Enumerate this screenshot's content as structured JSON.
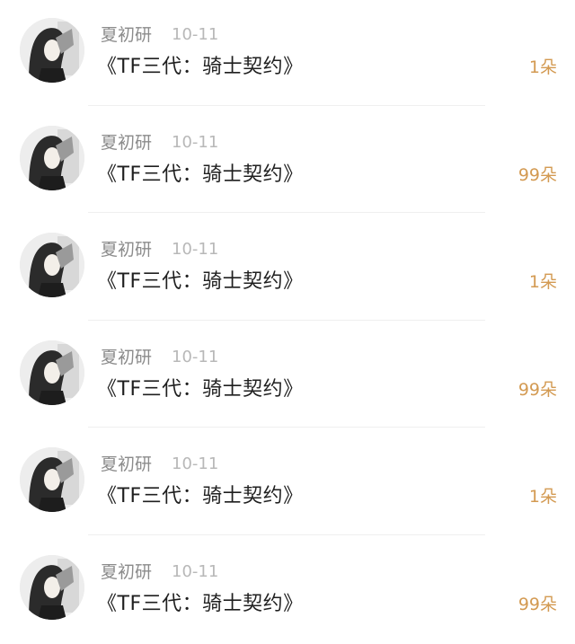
{
  "colors": {
    "username": "#8b8b8b",
    "date": "#b8b8b8",
    "title": "#1f1f1f",
    "count": "#d39a52",
    "divider": "#efefef"
  },
  "rows": [
    {
      "username": "夏初研",
      "date": "10-11",
      "title": "《TF三代：骑士契约》",
      "count": "1朵",
      "avatar_icon": "user-avatar"
    },
    {
      "username": "夏初研",
      "date": "10-11",
      "title": "《TF三代：骑士契约》",
      "count": "99朵",
      "avatar_icon": "user-avatar"
    },
    {
      "username": "夏初研",
      "date": "10-11",
      "title": "《TF三代：骑士契约》",
      "count": "1朵",
      "avatar_icon": "user-avatar"
    },
    {
      "username": "夏初研",
      "date": "10-11",
      "title": "《TF三代：骑士契约》",
      "count": "99朵",
      "avatar_icon": "user-avatar"
    },
    {
      "username": "夏初研",
      "date": "10-11",
      "title": "《TF三代：骑士契约》",
      "count": "1朵",
      "avatar_icon": "user-avatar"
    },
    {
      "username": "夏初研",
      "date": "10-11",
      "title": "《TF三代：骑士契约》",
      "count": "99朵",
      "avatar_icon": "user-avatar"
    }
  ]
}
